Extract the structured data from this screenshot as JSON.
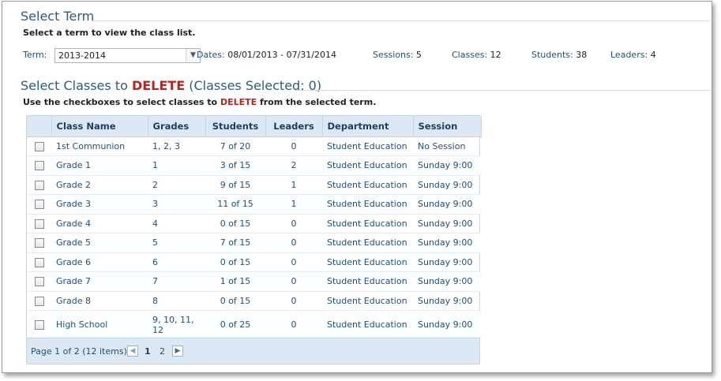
{
  "term_section": {
    "title": "Select Term",
    "hint": "Select a term to view the class list.",
    "term_label": "Term:",
    "term_value": "2013-2014",
    "dates_label": "Dates:",
    "dates_value": "08/01/2013 - 07/31/2014",
    "sessions_label": "Sessions:",
    "sessions_value": "5",
    "classes_label": "Classes:",
    "classes_value": "12",
    "students_label": "Students:",
    "students_value": "38",
    "leaders_label": "Leaders:",
    "leaders_value": "4"
  },
  "delete_section": {
    "title_pre": "Select Classes to ",
    "title_danger": "DELETE",
    "title_post": " (Classes Selected: 0)",
    "hint_pre": "Use the checkboxes to select classes to ",
    "hint_danger": "DELETE",
    "hint_post": " from the selected term."
  },
  "table": {
    "headers": [
      "",
      "Class Name",
      "Grades",
      "Students",
      "Leaders",
      "Department",
      "Session"
    ],
    "rows": [
      {
        "name": "1st Communion",
        "grades": "1, 2, 3",
        "students": "7 of 20",
        "leaders": "0",
        "department": "Student Education",
        "session": "No Session"
      },
      {
        "name": "Grade 1",
        "grades": "1",
        "students": "3 of 15",
        "leaders": "2",
        "department": "Student Education",
        "session": "Sunday 9:00"
      },
      {
        "name": "Grade 2",
        "grades": "2",
        "students": "9 of 15",
        "leaders": "1",
        "department": "Student Education",
        "session": "Sunday 9:00"
      },
      {
        "name": "Grade 3",
        "grades": "3",
        "students": "11 of 15",
        "leaders": "1",
        "department": "Student Education",
        "session": "Sunday 9:00"
      },
      {
        "name": "Grade 4",
        "grades": "4",
        "students": "0 of 15",
        "leaders": "0",
        "department": "Student Education",
        "session": "Sunday 9:00"
      },
      {
        "name": "Grade 5",
        "grades": "5",
        "students": "7 of 15",
        "leaders": "0",
        "department": "Student Education",
        "session": "Sunday 9:00"
      },
      {
        "name": "Grade 6",
        "grades": "6",
        "students": "0 of 15",
        "leaders": "0",
        "department": "Student Education",
        "session": "Sunday 9:00"
      },
      {
        "name": "Grade 7",
        "grades": "7",
        "students": "1 of 15",
        "leaders": "0",
        "department": "Student Education",
        "session": "Sunday 9:00"
      },
      {
        "name": "Grade 8",
        "grades": "8",
        "students": "0 of 15",
        "leaders": "0",
        "department": "Student Education",
        "session": "Sunday 9:00"
      },
      {
        "name": "High School",
        "grades": "9, 10, 11, 12",
        "students": "0 of 25",
        "leaders": "0",
        "department": "Student Education",
        "session": "Sunday 9:00"
      }
    ]
  },
  "pager": {
    "info": "Page 1 of 2 (12 items)",
    "prev_icon": "chevron-left-icon",
    "next_icon": "chevron-right-icon",
    "pages": [
      "1",
      "2"
    ],
    "current_page": "1"
  },
  "colors": {
    "title": "#2b5b88",
    "danger": "#b3261e",
    "header_bg": "#dce9f5"
  }
}
